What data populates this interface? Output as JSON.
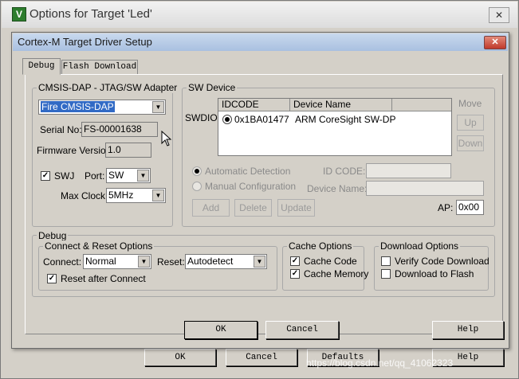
{
  "back_window": {
    "icon_text": "V",
    "title": "Options for Target 'Led'",
    "close_glyph": "✕",
    "buttons": {
      "ok": "OK",
      "cancel": "Cancel",
      "defaults": "Defaults",
      "help": "Help"
    }
  },
  "dialog": {
    "title": "Cortex-M Target Driver Setup",
    "close_glyph": "✕",
    "tabs": [
      {
        "label": "Debug",
        "active": true
      },
      {
        "label": "Flash Download",
        "active": false
      }
    ],
    "adapter": {
      "title": "CMSIS-DAP - JTAG/SW Adapter",
      "selected_adapter": "Fire CMSIS-DAP",
      "serial_label": "Serial No:",
      "serial_value": "FS-00001638",
      "firmware_label": "Firmware Version:",
      "firmware_value": "1.0",
      "swj_label": "SWJ",
      "swj_checked": true,
      "port_label": "Port:",
      "port_value": "SW",
      "max_clock_label": "Max Clock:",
      "max_clock_value": "5MHz"
    },
    "sw_device": {
      "title": "SW Device",
      "swdio_label": "SWDIO",
      "columns": [
        "IDCODE",
        "Device Name"
      ],
      "rows": [
        {
          "idcode": "0x1BA01477",
          "device_name": "ARM CoreSight SW-DP",
          "selected": true
        }
      ],
      "move_label": "Move",
      "up_label": "Up",
      "down_label": "Down",
      "auto_detect_label": "Automatic Detection",
      "manual_config_label": "Manual Configuration",
      "id_code_label": "ID CODE:",
      "device_name_label": "Device Name:",
      "add_label": "Add",
      "delete_label": "Delete",
      "update_label": "Update",
      "ap_label": "AP:",
      "ap_value": "0x00"
    },
    "debug": {
      "title": "Debug",
      "connect_reset": {
        "title": "Connect & Reset Options",
        "connect_label": "Connect:",
        "connect_value": "Normal",
        "reset_label": "Reset:",
        "reset_value": "Autodetect",
        "reset_after_connect_label": "Reset after Connect",
        "reset_after_connect_checked": true
      },
      "cache": {
        "title": "Cache Options",
        "cache_code_label": "Cache Code",
        "cache_code_checked": true,
        "cache_memory_label": "Cache Memory",
        "cache_memory_checked": true
      },
      "download": {
        "title": "Download Options",
        "verify_label": "Verify Code Download",
        "verify_checked": false,
        "download_flash_label": "Download to Flash",
        "download_flash_checked": false
      }
    },
    "buttons": {
      "ok": "OK",
      "cancel": "Cancel",
      "help": "Help"
    }
  },
  "watermark": "https://blog.csdn.net/qq_41062323"
}
